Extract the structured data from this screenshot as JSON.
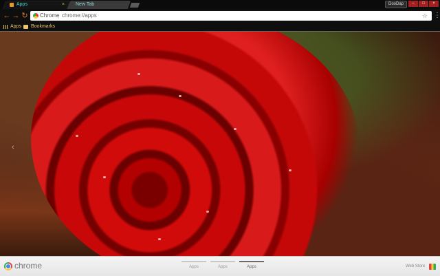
{
  "window": {
    "tabs": [
      {
        "title": "Apps",
        "close": "×"
      },
      {
        "title": "New Tab"
      }
    ],
    "user_chip": "DooDap",
    "buttons": [
      "–",
      "□",
      "×"
    ]
  },
  "toolbar": {
    "back": "←",
    "forward": "→",
    "reload": "↻",
    "omnibox_label": "Chrome",
    "omnibox_sep": "|",
    "url": "chrome://apps",
    "star": "☆",
    "menu": "⋮"
  },
  "bookmarks": {
    "apps": "Apps",
    "folder": "Bookmarks"
  },
  "content": {
    "prev_arrow": "‹"
  },
  "bottombar": {
    "brand": "chrome",
    "pages": [
      {
        "label": "Apps",
        "active": false
      },
      {
        "label": "Apps",
        "active": false
      },
      {
        "label": "Apps",
        "active": true
      }
    ],
    "web_store": "Web Store"
  },
  "colors": {
    "accent": "#e07a2b",
    "tab_text": "#48d6d6",
    "bookmark_text": "#e9c46a",
    "close_button": "#a22020"
  }
}
